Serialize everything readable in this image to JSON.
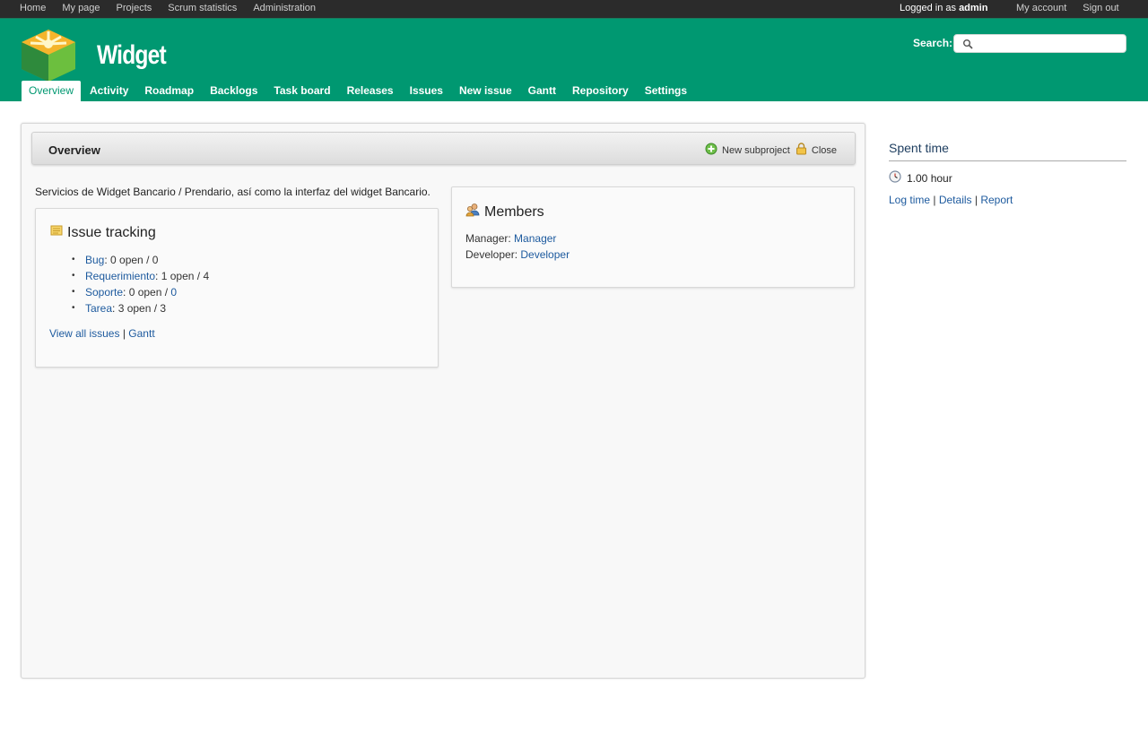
{
  "top_menu": {
    "left": [
      "Home",
      "My page",
      "Projects",
      "Scrum statistics",
      "Administration"
    ],
    "logged_as_prefix": "Logged in as",
    "logged_as_user": "admin",
    "right": [
      "My account",
      "Sign out"
    ]
  },
  "header": {
    "project_title": "Widget",
    "search_label": "Search:",
    "search_value": "",
    "tabs": [
      "Overview",
      "Activity",
      "Roadmap",
      "Backlogs",
      "Task board",
      "Releases",
      "Issues",
      "New issue",
      "Gantt",
      "Repository",
      "Settings"
    ],
    "selected_tab": "Overview"
  },
  "content": {
    "title": "Overview",
    "actions": {
      "new_subproject": "New subproject",
      "close": "Close"
    },
    "description": "Servicios de Widget Bancario / Prendario, así como la interfaz del widget Bancario."
  },
  "issue_tracking": {
    "title": "Issue tracking",
    "trackers": [
      {
        "name": "Bug",
        "sep": ": ",
        "open": "0 open",
        "slash": " / ",
        "total": "0",
        "total_link": false
      },
      {
        "name": "Requerimiento",
        "sep": ": ",
        "open": "1 open",
        "slash": " / ",
        "total": "4",
        "total_link": false
      },
      {
        "name": "Soporte",
        "sep": ": ",
        "open": "0 open",
        "slash": " / ",
        "total": "0",
        "total_link": true
      },
      {
        "name": "Tarea",
        "sep": ": ",
        "open": "3 open",
        "slash": " / ",
        "total": "3",
        "total_link": false
      }
    ],
    "links": {
      "view_all": "View all issues",
      "separator": "|",
      "gantt": "Gantt"
    }
  },
  "members": {
    "title": "Members",
    "rows": [
      {
        "role": "Manager:",
        "name": "Manager"
      },
      {
        "role": "Developer:",
        "name": "Developer"
      }
    ]
  },
  "sidebar": {
    "title": "Spent time",
    "hours": "1.00 hour",
    "links": {
      "log_time": "Log time",
      "details": "Details",
      "report": "Report",
      "separator": "|"
    }
  },
  "colors": {
    "header_green": "#009871",
    "top_bar": "#2b2b2b",
    "link": "#1d5a9e"
  },
  "icons": [
    "logo-cube-icon",
    "search-icon",
    "add-icon",
    "lock-icon",
    "issues-icon",
    "members-icon",
    "clock-icon"
  ]
}
